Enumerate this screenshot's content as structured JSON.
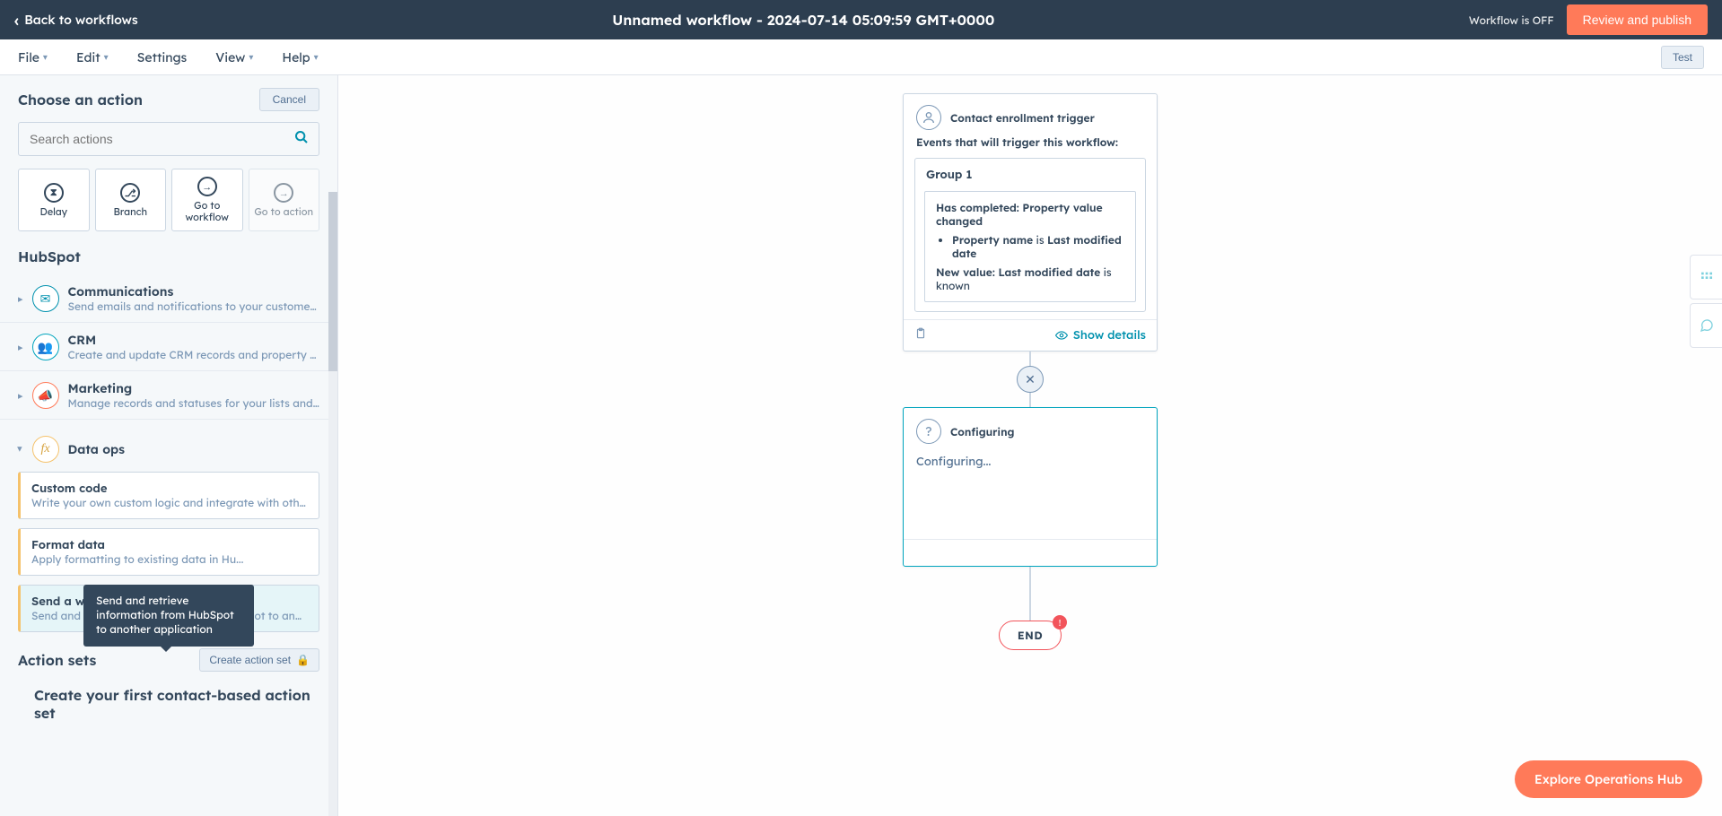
{
  "topbar": {
    "back": "Back to workflows",
    "title": "Unnamed workflow - 2024-07-14 05:09:59 GMT+0000",
    "status": "Workflow is OFF",
    "review": "Review and publish"
  },
  "menu": {
    "file": "File",
    "edit": "Edit",
    "settings": "Settings",
    "view": "View",
    "help": "Help",
    "test": "Test"
  },
  "sidebar": {
    "title": "Choose an action",
    "cancel": "Cancel",
    "search_placeholder": "Search actions",
    "quick": {
      "delay": "Delay",
      "branch": "Branch",
      "go_wf": "Go to workflow",
      "go_action": "Go to action"
    },
    "hubspot": "HubSpot",
    "categories": {
      "comm": {
        "title": "Communications",
        "desc": "Send emails and notifications to your customers and..."
      },
      "crm": {
        "title": "CRM",
        "desc": "Create and update CRM records and property values"
      },
      "mkt": {
        "title": "Marketing",
        "desc": "Manage records and statuses for your lists and audie..."
      },
      "data": {
        "title": "Data ops"
      }
    },
    "actions": {
      "custom": {
        "title": "Custom code",
        "desc": "Write your own custom logic and integrate with other applic..."
      },
      "format": {
        "title": "Format data",
        "desc": "Apply formatting to existing data in Hu..."
      },
      "webhook": {
        "title": "Send a webhook",
        "desc": "Send and retrieve information from HubSpot to another app..."
      }
    },
    "tooltip": "Send and retrieve information from HubSpot to another application",
    "sets_label": "Action sets",
    "create_set": "Create action set",
    "first_set": "Create your first contact-based action set"
  },
  "canvas": {
    "trigger": {
      "title": "Contact enrollment trigger",
      "subtitle": "Events that will trigger this workflow:",
      "group": "Group 1",
      "completed_prefix": "Has completed: ",
      "completed_val": "Property value changed",
      "prop_name_lbl": "Property name",
      "is": " is ",
      "prop_name_val": "Last modified date",
      "new_val_lbl": "New value: Last modified date",
      "known": " is known",
      "show_details": "Show details"
    },
    "config": {
      "title": "Configuring",
      "body": "Configuring..."
    },
    "end": "END"
  },
  "float": "Explore Operations Hub"
}
